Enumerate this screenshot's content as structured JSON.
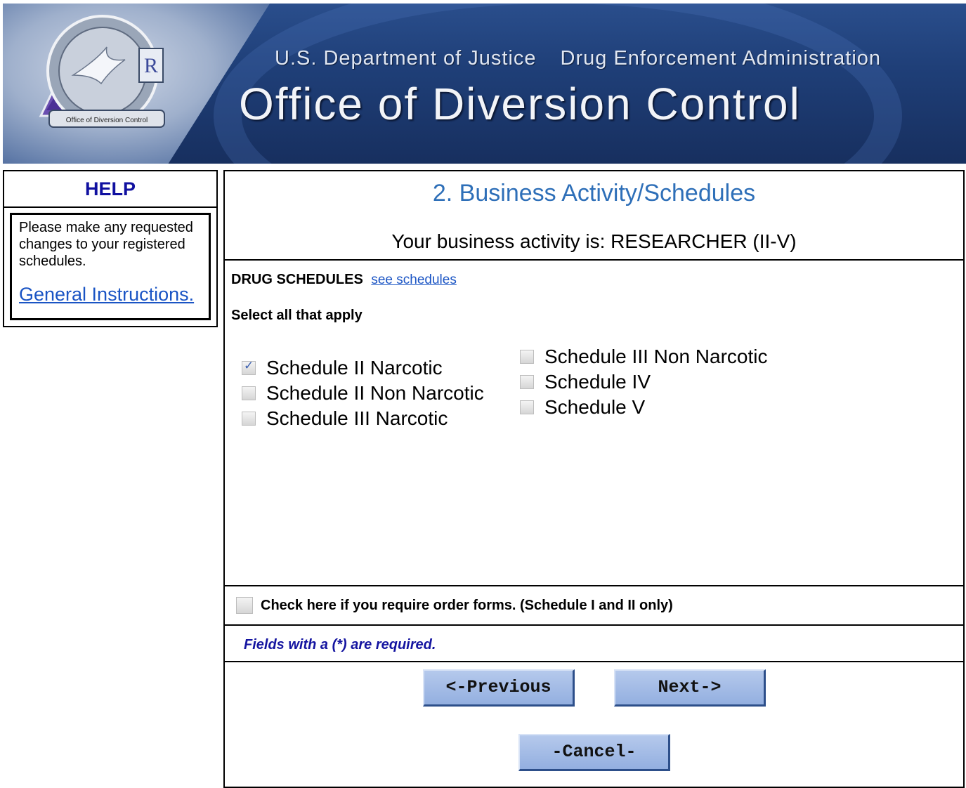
{
  "banner": {
    "agency_line_1": "U.S. Department of Justice",
    "agency_line_2": "Drug Enforcement Administration",
    "title": "Office of Diversion Control",
    "seal_caption": "Office of Diversion Control",
    "seal_letter": "R"
  },
  "help": {
    "heading": "HELP",
    "message": "Please make any requested changes to your registered schedules.",
    "link": "General Instructions."
  },
  "main": {
    "title": "2. Business Activity/Schedules",
    "activity": "Your business activity is: RESEARCHER (II-V)",
    "schedules_heading": "DRUG SCHEDULES",
    "see_schedules_link": "see schedules",
    "select_all": "Select all that apply",
    "schedules_left": [
      {
        "label": "Schedule II Narcotic",
        "checked": true
      },
      {
        "label": "Schedule II Non Narcotic",
        "checked": false
      },
      {
        "label": "Schedule III Narcotic",
        "checked": false
      }
    ],
    "schedules_right": [
      {
        "label": "Schedule III Non Narcotic",
        "checked": false
      },
      {
        "label": "Schedule IV",
        "checked": false
      },
      {
        "label": "Schedule V",
        "checked": false
      }
    ],
    "order_forms_label": "Check here if you require order forms. (Schedule I and II only)",
    "required_note": "Fields with a (*) are required."
  },
  "buttons": {
    "previous": "<-Previous",
    "next": "Next->",
    "cancel": "-Cancel-"
  },
  "colors": {
    "banner_blue": "#1f3f78",
    "title_blue": "#2e6fb8",
    "help_heading": "#1010a0",
    "link": "#1a54c4",
    "button": "#a4bce6"
  }
}
